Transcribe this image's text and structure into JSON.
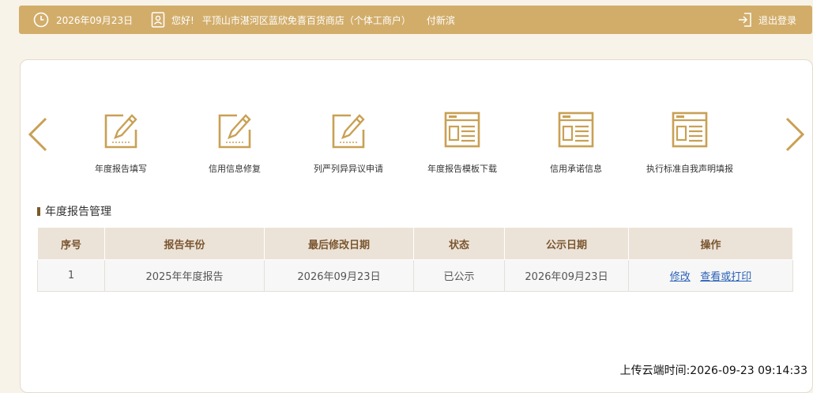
{
  "header": {
    "date": "2026年09月23日",
    "greeting": "您好!",
    "company": "平顶山市湛河区蓝欣免喜百货商店（个体工商户）",
    "person": "付新滨",
    "logout": "退出登录"
  },
  "nav": {
    "prev_icon": "chevron-left-icon",
    "next_icon": "chevron-right-icon",
    "tiles": [
      {
        "label": "年度报告填写",
        "icon": "edit-form-icon"
      },
      {
        "label": "信用信息修复",
        "icon": "edit-form-icon"
      },
      {
        "label": "列严列异异议申请",
        "icon": "edit-form-icon"
      },
      {
        "label": "年度报告模板下载",
        "icon": "template-doc-icon"
      },
      {
        "label": "信用承诺信息",
        "icon": "template-doc-icon"
      },
      {
        "label": "执行标准自我声明填报",
        "icon": "template-doc-icon"
      }
    ]
  },
  "section": {
    "title": "年度报告管理"
  },
  "table": {
    "headers": [
      "序号",
      "报告年份",
      "最后修改日期",
      "状态",
      "公示日期",
      "操作"
    ],
    "rows": [
      {
        "index": "1",
        "year": "2025年年度报告",
        "modified": "2026年09月23日",
        "status": "已公示",
        "published": "2026年09月23日",
        "action_edit": "修改",
        "action_view": "查看或打印"
      }
    ]
  },
  "footer": {
    "upload_time": "上传云端时间:2026-09-23 09:14:33"
  },
  "colors": {
    "accent": "#d2ad6a",
    "icon_gold": "#c9a054",
    "table_header_bg": "#ece3d8",
    "link": "#2a62b8"
  }
}
